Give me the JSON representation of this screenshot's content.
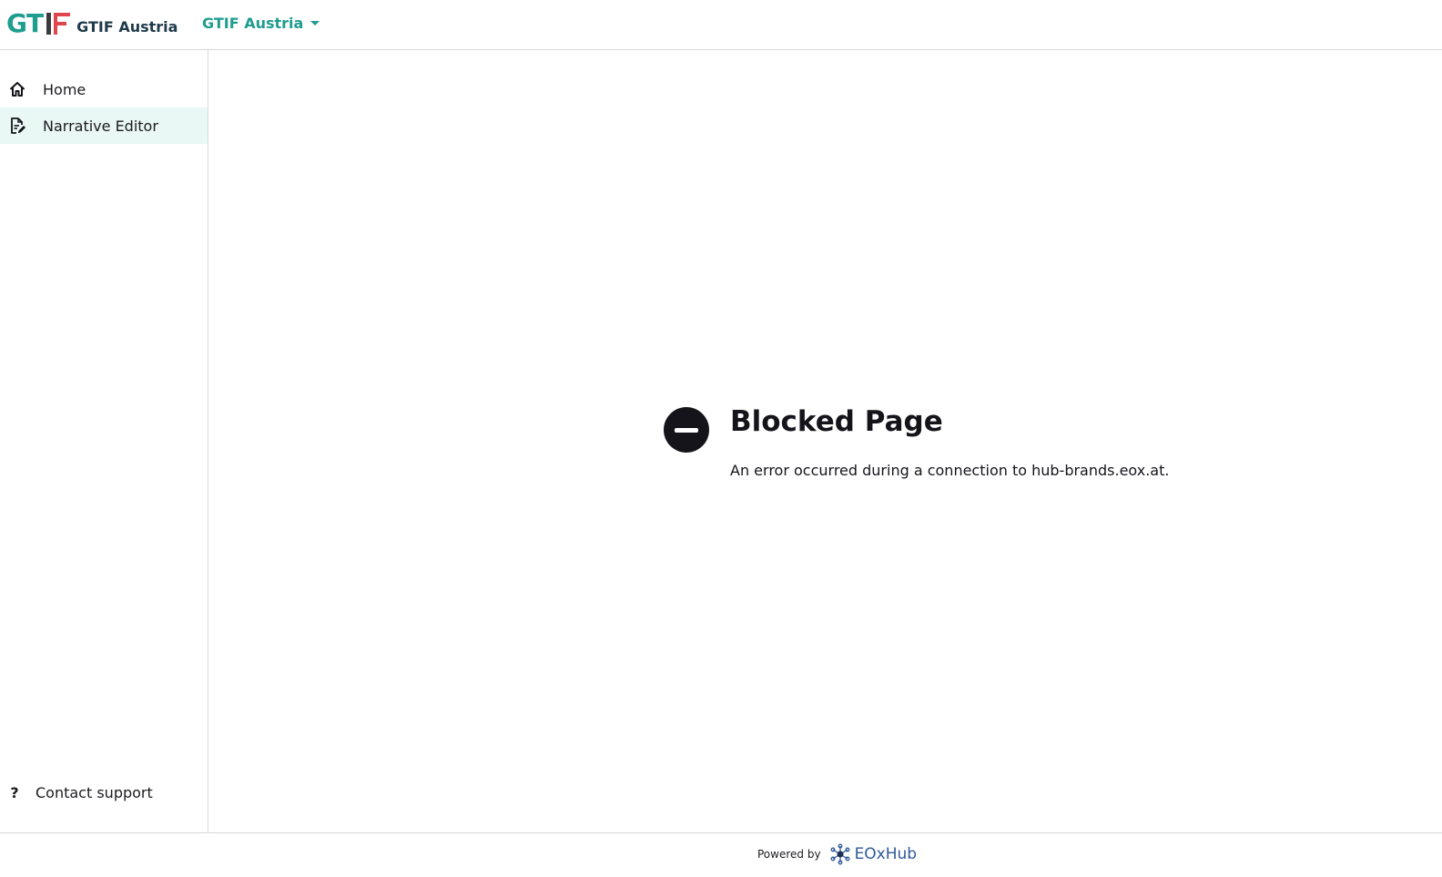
{
  "header": {
    "logo_text": "GTIF Austria",
    "logo_mark": {
      "g": "G",
      "t": "T"
    },
    "brand_select_label": "GTIF Austria"
  },
  "sidebar": {
    "items": [
      {
        "label": "Home",
        "icon": "home-icon",
        "active": false
      },
      {
        "label": "Narrative Editor",
        "icon": "edit-document-icon",
        "active": true
      }
    ],
    "support_label": "Contact support",
    "support_icon": "?"
  },
  "main": {
    "title": "Blocked Page",
    "message": "An error occurred during a connection to hub-brands.eox.at."
  },
  "footer": {
    "powered_by": "Powered by",
    "hub_name": "EOxHub"
  },
  "colors": {
    "accent": "#1f9d8f",
    "logo_red": "#e0454d",
    "active_bg": "#e9f7f5",
    "blocked_icon": "#15141a",
    "eox_blue": "#2f5a9a"
  }
}
